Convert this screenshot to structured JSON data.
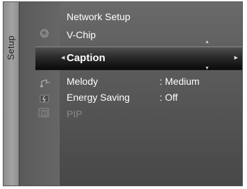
{
  "side_tab": {
    "label": "Setup"
  },
  "menu": {
    "items": [
      {
        "label": "Network Setup",
        "value": ""
      },
      {
        "label": "V-Chip",
        "value": ""
      },
      {
        "label": "Caption",
        "value": ""
      },
      {
        "label": "Melody",
        "value": ": Medium"
      },
      {
        "label": "Energy Saving",
        "value": ": Off"
      },
      {
        "label": "PIP",
        "value": ""
      }
    ]
  },
  "icons": [
    "globe-icon",
    "gear-icon",
    "note-icon",
    "energy-icon",
    "pip-icon"
  ],
  "colors": {
    "background": "#5a5a5a",
    "highlight": "#1a1a1a",
    "text": "#ffffff",
    "dim_text": "#8a8a8a"
  }
}
